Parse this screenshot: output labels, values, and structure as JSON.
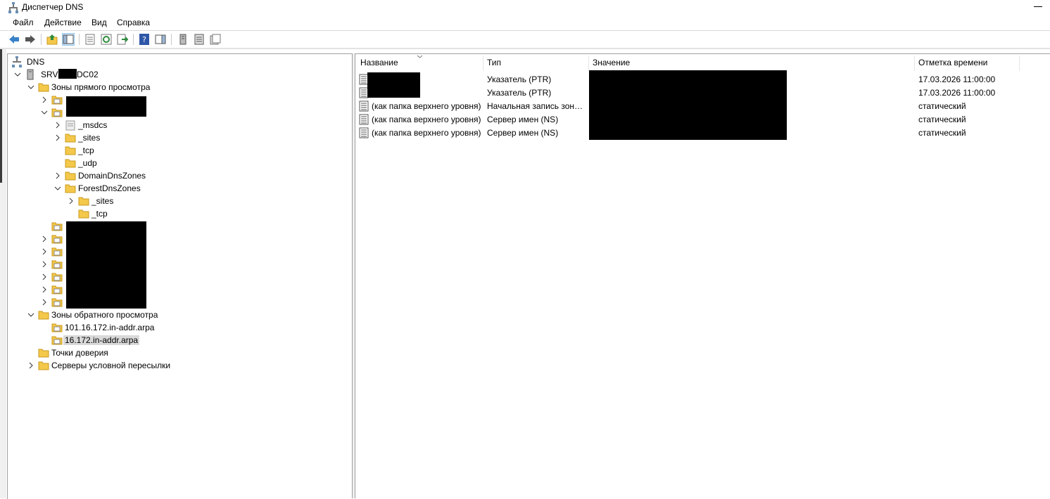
{
  "window": {
    "title": "Диспетчер DNS"
  },
  "menu": [
    "Файл",
    "Действие",
    "Вид",
    "Справка"
  ],
  "toolbar": {
    "icons": [
      "back-arrow-icon",
      "forward-arrow-icon",
      "up-folder-icon",
      "show-hide-console-tree-icon",
      "properties-icon",
      "refresh-icon",
      "export-list-icon",
      "help-icon",
      "action-pane-icon",
      "server-icon",
      "list-icon",
      "records-icon"
    ]
  },
  "tree": {
    "root": "DNS",
    "server": {
      "prefix": "SRV",
      "suffix": "DC02"
    },
    "forward_zones": "Зоны прямого просмотра",
    "forward_children": [
      "_msdcs",
      "_sites",
      "_tcp",
      "_udp",
      "DomainDnsZones",
      "ForestDnsZones"
    ],
    "forest_children": [
      "_sites",
      "_tcp"
    ],
    "reverse_zones": "Зоны обратного просмотра",
    "reverse_children": [
      "101.16.172.in-addr.arpa",
      "16.172.in-addr.arpa"
    ],
    "trust_points": "Точки доверия",
    "conditional_forwarders": "Серверы условной пересылки"
  },
  "list": {
    "columns": [
      "Название",
      "Тип",
      "Значение",
      "Отметка времени"
    ],
    "rows": [
      {
        "name": "",
        "type": "Указатель (PTR)",
        "value": "",
        "timestamp": "17.03.2026 11:00:00"
      },
      {
        "name": "",
        "type": "Указатель (PTR)",
        "value": "",
        "timestamp": "17.03.2026 11:00:00"
      },
      {
        "name": "(как папка верхнего уровня)",
        "type": "Начальная запись зон…",
        "value": "",
        "timestamp": "статический"
      },
      {
        "name": "(как папка верхнего уровня)",
        "type": "Сервер имен (NS)",
        "value": "",
        "timestamp": "статический"
      },
      {
        "name": "(как папка верхнего уровня)",
        "type": "Сервер имен (NS)",
        "value": "",
        "timestamp": "статический"
      }
    ]
  },
  "colors": {
    "selection": "#d9d9d9",
    "redaction": "#000000",
    "folder": "#f4c84a"
  }
}
